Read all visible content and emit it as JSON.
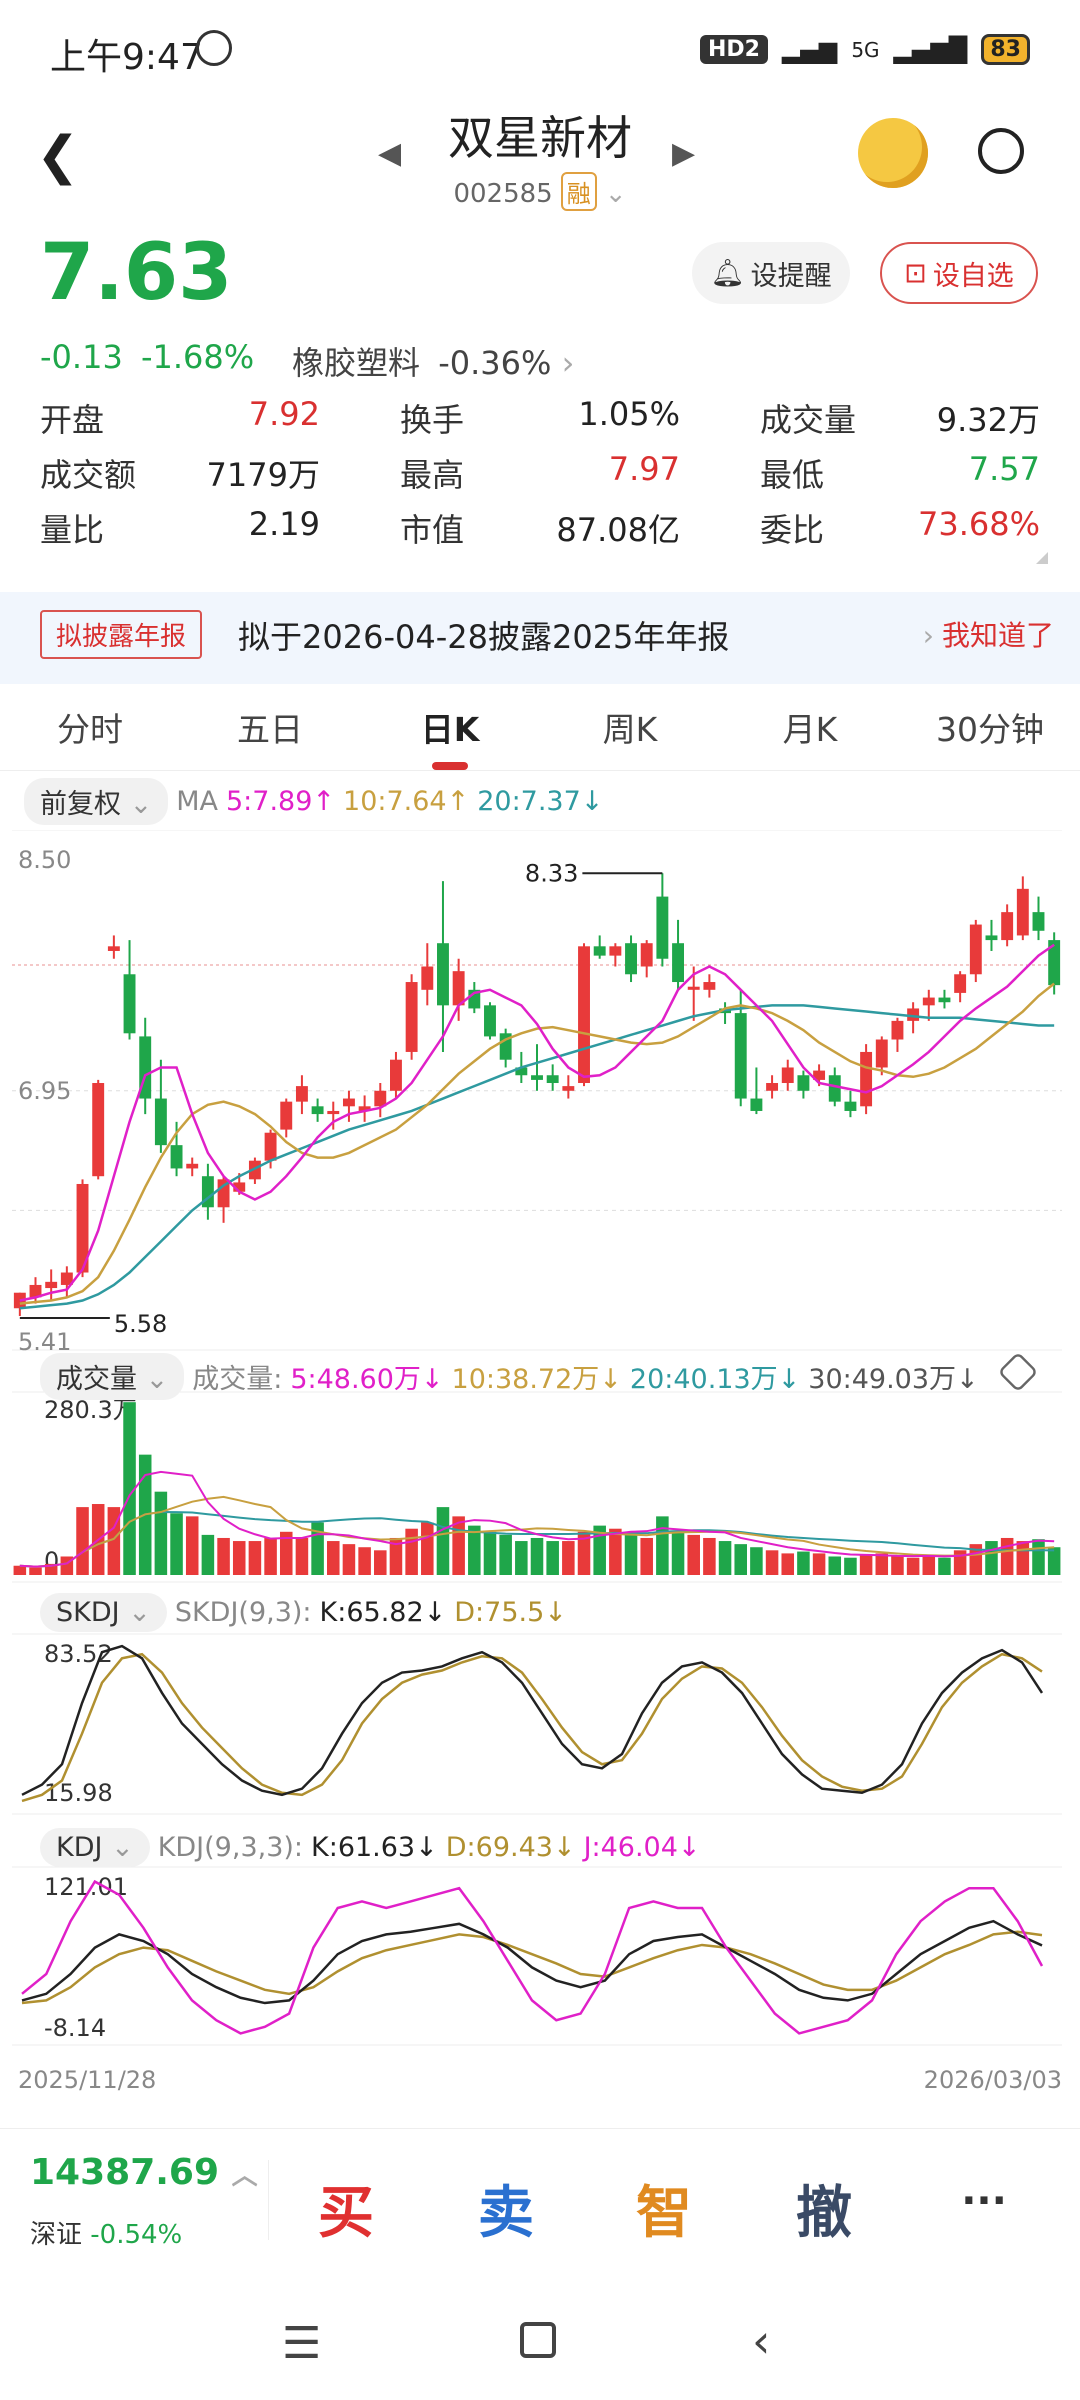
{
  "status": {
    "time": "上午9:47",
    "net": "HD2",
    "signal": "5G",
    "battery": "83"
  },
  "header": {
    "stock_name": "双星新材",
    "code": "002585",
    "margin_tag": "融"
  },
  "quote": {
    "price": "7.63",
    "change": "-0.13",
    "change_pct": "-1.68%",
    "sector": "橡胶塑料",
    "sector_pct": "-0.36%",
    "alert_btn": "设提醒",
    "watch_btn": "设自选",
    "rows": [
      [
        {
          "l": "开盘",
          "v": "7.92",
          "c": "red"
        },
        {
          "l": "换手",
          "v": "1.05%",
          "c": "black"
        },
        {
          "l": "成交量",
          "v": "9.32万",
          "c": "black"
        }
      ],
      [
        {
          "l": "成交额",
          "v": "7179万",
          "c": "black"
        },
        {
          "l": "最高",
          "v": "7.97",
          "c": "red"
        },
        {
          "l": "最低",
          "v": "7.57",
          "c": "green"
        }
      ],
      [
        {
          "l": "量比",
          "v": "2.19",
          "c": "black"
        },
        {
          "l": "市值",
          "v": "87.08亿",
          "c": "black"
        },
        {
          "l": "委比",
          "v": "73.68%",
          "c": "red"
        }
      ]
    ]
  },
  "notice": {
    "tag": "拟披露年报",
    "text": "拟于2026-04-28披露2025年年报",
    "action": "我知道了"
  },
  "tabs": [
    "分时",
    "五日",
    "日K",
    "周K",
    "月K",
    "30分钟"
  ],
  "active_tab": 2,
  "ma_bar": {
    "adj": "前复权",
    "label": "MA",
    "ma5": "5:7.89",
    "ma10": "10:7.64",
    "ma20": "20:7.37"
  },
  "vol_bar": {
    "pill": "成交量",
    "label": "成交量:",
    "v5": "5:48.60万",
    "v10": "10:38.72万",
    "v20": "20:40.13万",
    "v30": "30:49.03万"
  },
  "skdj_bar": {
    "pill": "SKDJ",
    "label": "SKDJ(9,3):",
    "k": "K:65.82",
    "d": "D:75.5"
  },
  "kdj_bar": {
    "pill": "KDJ",
    "label": "KDJ(9,3,3):",
    "k": "K:61.63",
    "d": "D:69.43",
    "j": "J:46.04"
  },
  "colors": {
    "up": "#e83a3a",
    "down": "#1fa64a",
    "ma5": "#e020c8",
    "ma10": "#c8a040",
    "ma20": "#2f9aa0",
    "k": "#222222",
    "d": "#b09030",
    "j": "#e020c8"
  },
  "chart_data": [
    {
      "type": "candlestick",
      "title": "日K",
      "ylim": [
        5.41,
        8.5
      ],
      "y_ticks": [
        "8.50",
        "6.95",
        "5.41"
      ],
      "high_label": "8.33",
      "low_label": "5.58",
      "ohlc": [
        [
          5.55,
          5.65,
          5.5,
          5.65
        ],
        [
          5.62,
          5.75,
          5.58,
          5.7
        ],
        [
          5.68,
          5.8,
          5.6,
          5.72
        ],
        [
          5.7,
          5.82,
          5.62,
          5.78
        ],
        [
          5.78,
          6.38,
          5.75,
          6.35
        ],
        [
          6.4,
          7.02,
          6.38,
          7.0
        ],
        [
          7.85,
          7.95,
          7.8,
          7.88
        ],
        [
          7.7,
          7.92,
          7.28,
          7.32
        ],
        [
          7.3,
          7.42,
          6.8,
          6.9
        ],
        [
          6.9,
          7.15,
          6.55,
          6.6
        ],
        [
          6.6,
          6.75,
          6.4,
          6.45
        ],
        [
          6.45,
          6.52,
          6.4,
          6.48
        ],
        [
          6.4,
          6.48,
          6.12,
          6.2
        ],
        [
          6.2,
          6.4,
          6.1,
          6.38
        ],
        [
          6.3,
          6.42,
          6.28,
          6.36
        ],
        [
          6.38,
          6.52,
          6.35,
          6.5
        ],
        [
          6.5,
          6.7,
          6.45,
          6.68
        ],
        [
          6.7,
          6.9,
          6.65,
          6.88
        ],
        [
          6.88,
          7.05,
          6.8,
          6.98
        ],
        [
          6.85,
          6.9,
          6.75,
          6.8
        ],
        [
          6.8,
          6.88,
          6.7,
          6.82
        ],
        [
          6.85,
          6.95,
          6.75,
          6.9
        ],
        [
          6.82,
          6.92,
          6.75,
          6.85
        ],
        [
          6.85,
          7.0,
          6.78,
          6.95
        ],
        [
          6.95,
          7.2,
          6.9,
          7.15
        ],
        [
          7.2,
          7.7,
          7.15,
          7.65
        ],
        [
          7.6,
          7.9,
          7.5,
          7.75
        ],
        [
          7.9,
          8.3,
          7.2,
          7.5
        ],
        [
          7.5,
          7.8,
          7.4,
          7.72
        ],
        [
          7.6,
          7.65,
          7.45,
          7.48
        ],
        [
          7.5,
          7.52,
          7.28,
          7.3
        ],
        [
          7.32,
          7.35,
          7.1,
          7.15
        ],
        [
          7.1,
          7.2,
          7.0,
          7.05
        ],
        [
          7.05,
          7.25,
          6.95,
          7.02
        ],
        [
          7.05,
          7.12,
          6.95,
          7.0
        ],
        [
          6.95,
          7.05,
          6.9,
          6.98
        ],
        [
          7.0,
          7.9,
          6.98,
          7.88
        ],
        [
          7.88,
          7.95,
          7.8,
          7.82
        ],
        [
          7.82,
          7.9,
          7.75,
          7.88
        ],
        [
          7.9,
          7.95,
          7.65,
          7.7
        ],
        [
          7.75,
          7.92,
          7.68,
          7.9
        ],
        [
          8.2,
          8.35,
          7.75,
          7.8
        ],
        [
          7.9,
          8.05,
          7.6,
          7.65
        ],
        [
          7.6,
          7.75,
          7.4,
          7.62
        ],
        [
          7.6,
          7.7,
          7.55,
          7.65
        ],
        [
          7.48,
          7.52,
          7.38,
          7.45
        ],
        [
          7.45,
          7.6,
          6.85,
          6.9
        ],
        [
          6.9,
          7.1,
          6.8,
          6.82
        ],
        [
          6.95,
          7.05,
          6.9,
          7.0
        ],
        [
          7.0,
          7.15,
          6.95,
          7.1
        ],
        [
          7.05,
          7.08,
          6.9,
          6.95
        ],
        [
          7.02,
          7.12,
          6.98,
          7.08
        ],
        [
          7.05,
          7.1,
          6.85,
          6.88
        ],
        [
          6.88,
          6.95,
          6.78,
          6.82
        ],
        [
          6.85,
          7.25,
          6.8,
          7.2
        ],
        [
          7.1,
          7.3,
          7.05,
          7.28
        ],
        [
          7.28,
          7.42,
          7.2,
          7.4
        ],
        [
          7.4,
          7.52,
          7.32,
          7.48
        ],
        [
          7.5,
          7.6,
          7.4,
          7.55
        ],
        [
          7.55,
          7.6,
          7.48,
          7.52
        ],
        [
          7.58,
          7.72,
          7.52,
          7.7
        ],
        [
          7.7,
          8.05,
          7.65,
          8.02
        ],
        [
          7.95,
          8.05,
          7.85,
          7.92
        ],
        [
          7.92,
          8.15,
          7.88,
          8.1
        ],
        [
          7.95,
          8.33,
          7.92,
          8.25
        ],
        [
          8.1,
          8.2,
          7.92,
          7.98
        ],
        [
          7.92,
          7.97,
          7.57,
          7.63
        ]
      ],
      "ma5": [
        5.6,
        5.62,
        5.65,
        5.67,
        5.8,
        6.05,
        6.4,
        6.75,
        7.05,
        7.1,
        7.1,
        6.8,
        6.55,
        6.4,
        6.3,
        6.25,
        6.3,
        6.4,
        6.52,
        6.65,
        6.75,
        6.8,
        6.82,
        6.84,
        6.9,
        7.0,
        7.15,
        7.3,
        7.5,
        7.58,
        7.6,
        7.55,
        7.5,
        7.38,
        7.22,
        7.1,
        7.04,
        7.05,
        7.1,
        7.2,
        7.3,
        7.4,
        7.6,
        7.7,
        7.75,
        7.7,
        7.6,
        7.5,
        7.4,
        7.25,
        7.1,
        7.0,
        6.98,
        6.96,
        6.94,
        6.98,
        7.05,
        7.12,
        7.2,
        7.3,
        7.4,
        7.48,
        7.55,
        7.62,
        7.72,
        7.82,
        7.89
      ],
      "ma10": [
        5.58,
        5.59,
        5.6,
        5.62,
        5.66,
        5.75,
        5.92,
        6.12,
        6.33,
        6.52,
        6.68,
        6.8,
        6.86,
        6.88,
        6.85,
        6.8,
        6.72,
        6.62,
        6.55,
        6.52,
        6.52,
        6.55,
        6.6,
        6.65,
        6.7,
        6.78,
        6.86,
        6.96,
        7.06,
        7.14,
        7.22,
        7.28,
        7.32,
        7.35,
        7.36,
        7.34,
        7.32,
        7.3,
        7.28,
        7.26,
        7.25,
        7.26,
        7.3,
        7.36,
        7.42,
        7.48,
        7.5,
        7.48,
        7.45,
        7.4,
        7.34,
        7.26,
        7.2,
        7.14,
        7.1,
        7.08,
        7.05,
        7.04,
        7.06,
        7.1,
        7.16,
        7.22,
        7.3,
        7.38,
        7.46,
        7.56,
        7.64
      ],
      "ma20": [
        5.55,
        5.56,
        5.57,
        5.58,
        5.6,
        5.64,
        5.7,
        5.78,
        5.88,
        5.98,
        6.08,
        6.18,
        6.26,
        6.34,
        6.4,
        6.45,
        6.5,
        6.54,
        6.58,
        6.62,
        6.66,
        6.7,
        6.73,
        6.76,
        6.79,
        6.82,
        6.86,
        6.9,
        6.94,
        6.98,
        7.02,
        7.06,
        7.1,
        7.13,
        7.16,
        7.19,
        7.22,
        7.25,
        7.28,
        7.31,
        7.34,
        7.37,
        7.4,
        7.43,
        7.45,
        7.47,
        7.48,
        7.49,
        7.5,
        7.5,
        7.5,
        7.49,
        7.48,
        7.47,
        7.46,
        7.45,
        7.44,
        7.43,
        7.42,
        7.42,
        7.42,
        7.41,
        7.4,
        7.39,
        7.38,
        7.37,
        7.37
      ]
    },
    {
      "type": "bar",
      "title": "成交量",
      "y_ticks": [
        "280.3万",
        "0"
      ],
      "ylim": [
        0,
        280.3
      ],
      "values": [
        15,
        12,
        18,
        30,
        110,
        115,
        110,
        280,
        195,
        135,
        100,
        95,
        65,
        60,
        55,
        55,
        60,
        70,
        60,
        85,
        55,
        50,
        45,
        40,
        60,
        75,
        85,
        110,
        95,
        80,
        70,
        65,
        55,
        60,
        55,
        55,
        70,
        80,
        75,
        70,
        60,
        95,
        70,
        65,
        60,
        55,
        50,
        45,
        40,
        35,
        38,
        35,
        30,
        28,
        32,
        35,
        30,
        28,
        30,
        28,
        40,
        50,
        55,
        60,
        55,
        58,
        45
      ]
    },
    {
      "type": "line",
      "title": "SKDJ",
      "y_ticks": [
        "83.52",
        "15.98"
      ],
      "series": [
        {
          "name": "K",
          "values": [
            15,
            20,
            30,
            60,
            85,
            88,
            82,
            65,
            50,
            40,
            30,
            22,
            17,
            15,
            18,
            28,
            45,
            60,
            70,
            75,
            76,
            78,
            82,
            85,
            80,
            70,
            55,
            40,
            30,
            28,
            35,
            55,
            70,
            78,
            80,
            75,
            65,
            50,
            35,
            25,
            18,
            17,
            16,
            20,
            30,
            50,
            65,
            75,
            82,
            86,
            80,
            65
          ]
        },
        {
          "name": "D",
          "values": [
            12,
            15,
            22,
            45,
            70,
            82,
            84,
            75,
            60,
            48,
            38,
            28,
            20,
            16,
            15,
            20,
            32,
            50,
            62,
            70,
            74,
            76,
            80,
            83,
            82,
            75,
            62,
            48,
            36,
            30,
            32,
            45,
            62,
            72,
            78,
            77,
            70,
            58,
            44,
            32,
            24,
            19,
            17,
            18,
            24,
            40,
            58,
            70,
            78,
            84,
            82,
            75.5
          ]
        }
      ]
    },
    {
      "type": "line",
      "title": "KDJ",
      "y_ticks": [
        "121.01",
        "-8.14"
      ],
      "series": [
        {
          "name": "K",
          "values": [
            20,
            25,
            40,
            60,
            70,
            65,
            55,
            40,
            30,
            22,
            18,
            20,
            35,
            55,
            65,
            70,
            72,
            75,
            78,
            70,
            60,
            45,
            35,
            30,
            35,
            55,
            65,
            68,
            70,
            60,
            50,
            40,
            28,
            22,
            20,
            25,
            40,
            55,
            65,
            75,
            80,
            70,
            61.63
          ]
        },
        {
          "name": "D",
          "values": [
            18,
            20,
            30,
            45,
            55,
            60,
            58,
            50,
            42,
            35,
            28,
            25,
            30,
            42,
            52,
            58,
            62,
            66,
            70,
            68,
            62,
            55,
            48,
            40,
            38,
            45,
            52,
            58,
            62,
            60,
            55,
            48,
            40,
            32,
            28,
            28,
            35,
            45,
            55,
            62,
            70,
            72,
            69.43
          ]
        },
        {
          "name": "J",
          "values": [
            25,
            40,
            80,
            110,
            100,
            75,
            45,
            20,
            5,
            -5,
            0,
            10,
            60,
            90,
            95,
            90,
            95,
            100,
            105,
            80,
            50,
            20,
            5,
            10,
            40,
            90,
            95,
            90,
            90,
            60,
            35,
            10,
            -5,
            0,
            5,
            20,
            55,
            80,
            95,
            105,
            105,
            80,
            46.04
          ]
        }
      ]
    }
  ],
  "x_range": {
    "start": "2025/11/28",
    "end": "2026/03/03"
  },
  "index": {
    "value": "14387.69",
    "name": "深证",
    "pct": "-0.54%"
  },
  "actions": [
    "买",
    "卖",
    "智",
    "撤",
    "···"
  ]
}
